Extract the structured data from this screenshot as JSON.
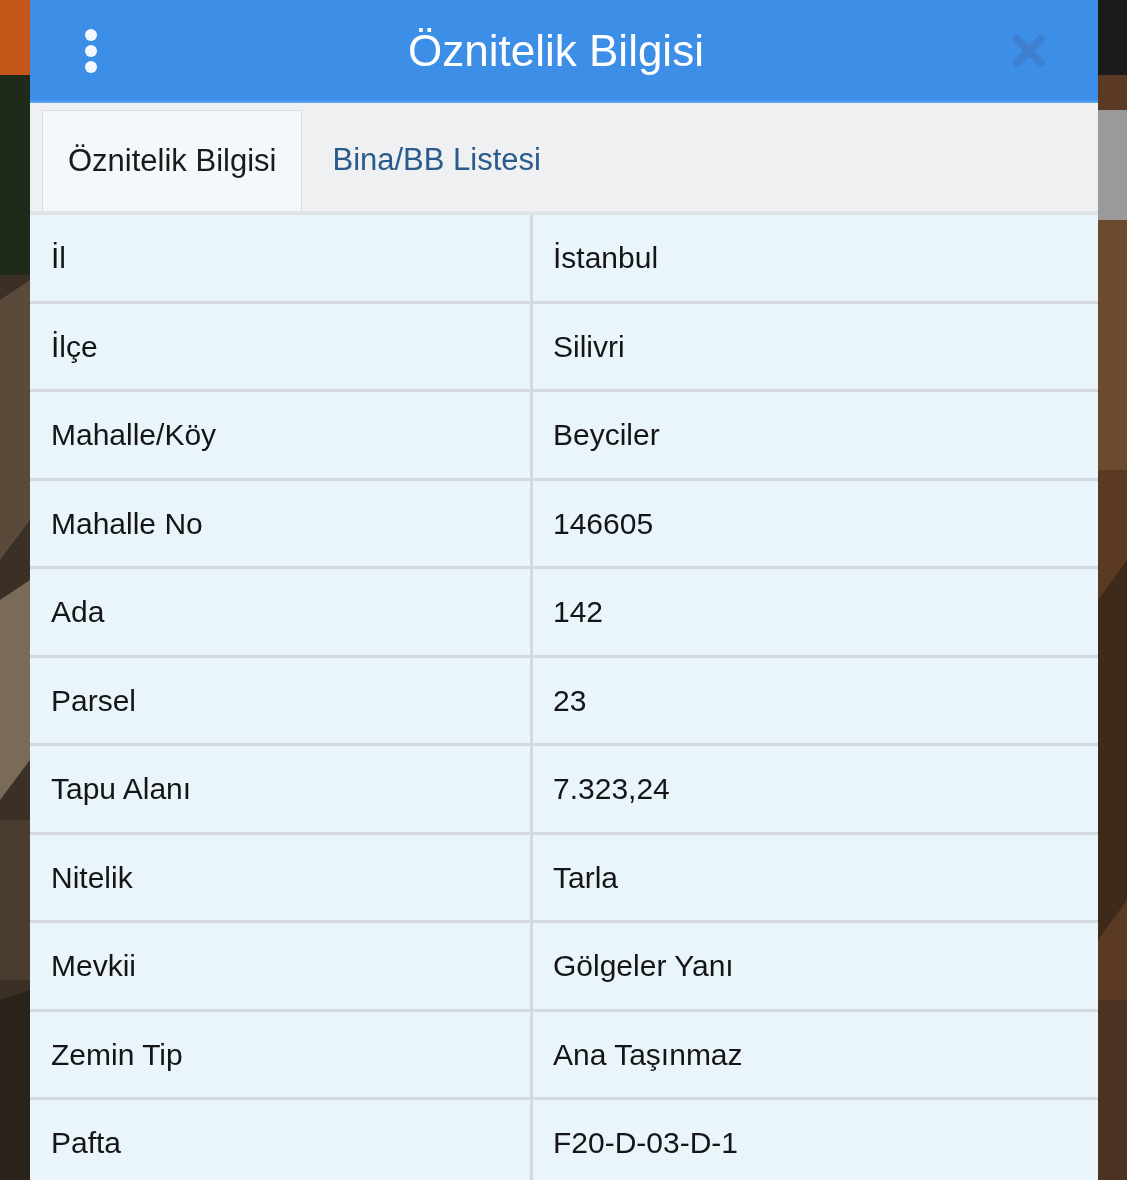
{
  "header": {
    "title": "Öznitelik Bilgisi"
  },
  "tabs": [
    {
      "label": "Öznitelik Bilgisi",
      "selected": true
    },
    {
      "label": "Bina/BB Listesi",
      "selected": false
    }
  ],
  "table": {
    "rows": [
      {
        "label": "İl",
        "value": "İstanbul"
      },
      {
        "label": "İlçe",
        "value": "Silivri"
      },
      {
        "label": "Mahalle/Köy",
        "value": "Beyciler"
      },
      {
        "label": "Mahalle No",
        "value": "146605"
      },
      {
        "label": "Ada",
        "value": "142"
      },
      {
        "label": "Parsel",
        "value": "23"
      },
      {
        "label": "Tapu Alanı",
        "value": "7.323,24"
      },
      {
        "label": "Nitelik",
        "value": "Tarla"
      },
      {
        "label": "Mevkii",
        "value": "Gölgeler Yanı"
      },
      {
        "label": "Zemin Tip",
        "value": "Ana Taşınmaz"
      },
      {
        "label": "Pafta",
        "value": "F20-D-03-D-1"
      }
    ]
  }
}
